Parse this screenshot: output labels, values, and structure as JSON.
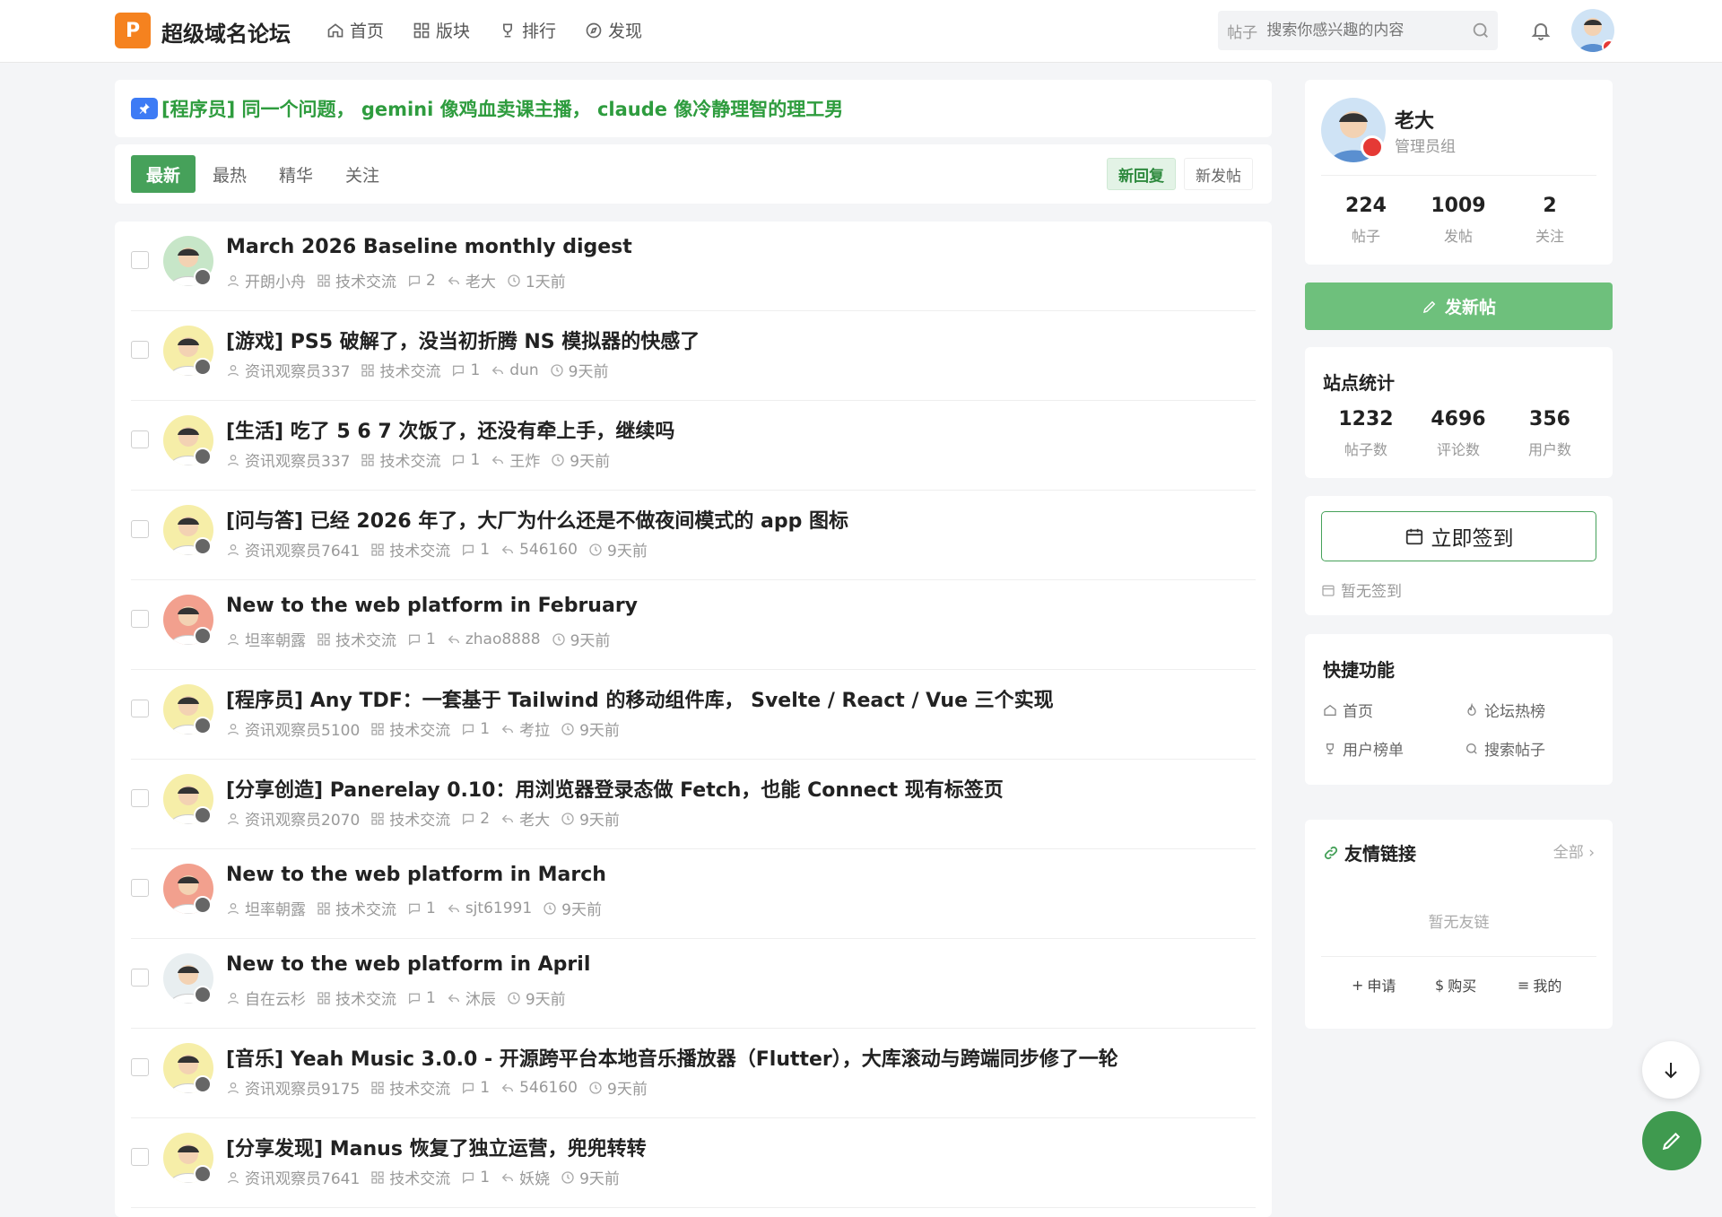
{
  "header": {
    "logo_letter": "P",
    "site_name": "超级域名论坛",
    "nav": [
      {
        "label": "首页",
        "icon": "home-icon"
      },
      {
        "label": "版块",
        "icon": "grid-icon"
      },
      {
        "label": "排行",
        "icon": "trophy-icon"
      },
      {
        "label": "发现",
        "icon": "compass-icon"
      }
    ],
    "search": {
      "type": "帖子",
      "placeholder": "搜索你感兴趣的内容"
    }
  },
  "notice": {
    "text": "[程序员] 同一个问题， gemini 像鸡血卖课主播， claude 像冷静理智的理工男"
  },
  "tabs": [
    "最新",
    "最热",
    "精华",
    "关注"
  ],
  "sort": {
    "active": "新回复",
    "other": "新发帖"
  },
  "threads": [
    {
      "title": "March 2026 Baseline monthly digest",
      "author": "开朗小舟",
      "board": "技术交流",
      "replies": "2",
      "last": "老大",
      "time": "1天前",
      "ava": "#c7e6c8"
    },
    {
      "title": "[游戏] PS5 破解了，没当初折腾 NS 模拟器的快感了",
      "author": "资讯观察员337",
      "board": "技术交流",
      "replies": "1",
      "last": "dun",
      "time": "9天前",
      "ava": "#f6eea8"
    },
    {
      "title": "[生活] 吃了 5 6 7 次饭了，还没有牵上手，继续吗",
      "author": "资讯观察员337",
      "board": "技术交流",
      "replies": "1",
      "last": "王炸",
      "time": "9天前",
      "ava": "#f6eea8"
    },
    {
      "title": "[问与答] 已经 2026 年了，大厂为什么还是不做夜间模式的 app 图标",
      "author": "资讯观察员7641",
      "board": "技术交流",
      "replies": "1",
      "last": "546160",
      "time": "9天前",
      "ava": "#f6eea8"
    },
    {
      "title": "New to the web platform in February",
      "author": "坦率朝露",
      "board": "技术交流",
      "replies": "1",
      "last": "zhao8888",
      "time": "9天前",
      "ava": "#f2a08e"
    },
    {
      "title": "[程序员] Any TDF：一套基于 Tailwind 的移动组件库， Svelte / React / Vue 三个实现",
      "author": "资讯观察员5100",
      "board": "技术交流",
      "replies": "1",
      "last": "考拉",
      "time": "9天前",
      "ava": "#f6eea8"
    },
    {
      "title": "[分享创造] Panerelay 0.10：用浏览器登录态做 Fetch，也能 Connect 现有标签页",
      "author": "资讯观察员2070",
      "board": "技术交流",
      "replies": "2",
      "last": "老大",
      "time": "9天前",
      "ava": "#f6eea8"
    },
    {
      "title": "New to the web platform in March",
      "author": "坦率朝露",
      "board": "技术交流",
      "replies": "1",
      "last": "sjt61991",
      "time": "9天前",
      "ava": "#f2a08e"
    },
    {
      "title": "New to the web platform in April",
      "author": "自在云杉",
      "board": "技术交流",
      "replies": "1",
      "last": "沐辰",
      "time": "9天前",
      "ava": "#e8eef0"
    },
    {
      "title": "[音乐] Yeah Music 3.0.0 - 开源跨平台本地音乐播放器（Flutter），大库滚动与跨端同步修了一轮",
      "author": "资讯观察员9175",
      "board": "技术交流",
      "replies": "1",
      "last": "546160",
      "time": "9天前",
      "ava": "#f6eea8"
    },
    {
      "title": "[分享发现] Manus 恢复了独立运营，兜兜转转",
      "author": "资讯观察员7641",
      "board": "技术交流",
      "replies": "1",
      "last": "妖娆",
      "time": "9天前",
      "ava": "#f6eea8"
    }
  ],
  "profile": {
    "name": "老大",
    "role": "管理员组",
    "stats": [
      {
        "value": "224",
        "label": "帖子"
      },
      {
        "value": "1009",
        "label": "发帖"
      },
      {
        "value": "2",
        "label": "关注"
      }
    ]
  },
  "new_post_label": "发新帖",
  "site_stats": {
    "title": "站点统计",
    "items": [
      {
        "value": "1232",
        "label": "帖子数"
      },
      {
        "value": "4696",
        "label": "评论数"
      },
      {
        "value": "356",
        "label": "用户数"
      }
    ]
  },
  "checkin": {
    "button": "立即签到",
    "none": "暂无签到"
  },
  "quick": {
    "title": "快捷功能",
    "items": [
      "首页",
      "论坛热榜",
      "用户榜单",
      "搜索帖子"
    ]
  },
  "links": {
    "title": "友情链接",
    "all": "全部",
    "empty": "暂无友链",
    "actions": [
      "申请",
      "购买",
      "我的"
    ]
  },
  "colors": {
    "accent": "#46a15a",
    "logo": "#f5821f",
    "notice": "#2e9c3e"
  }
}
